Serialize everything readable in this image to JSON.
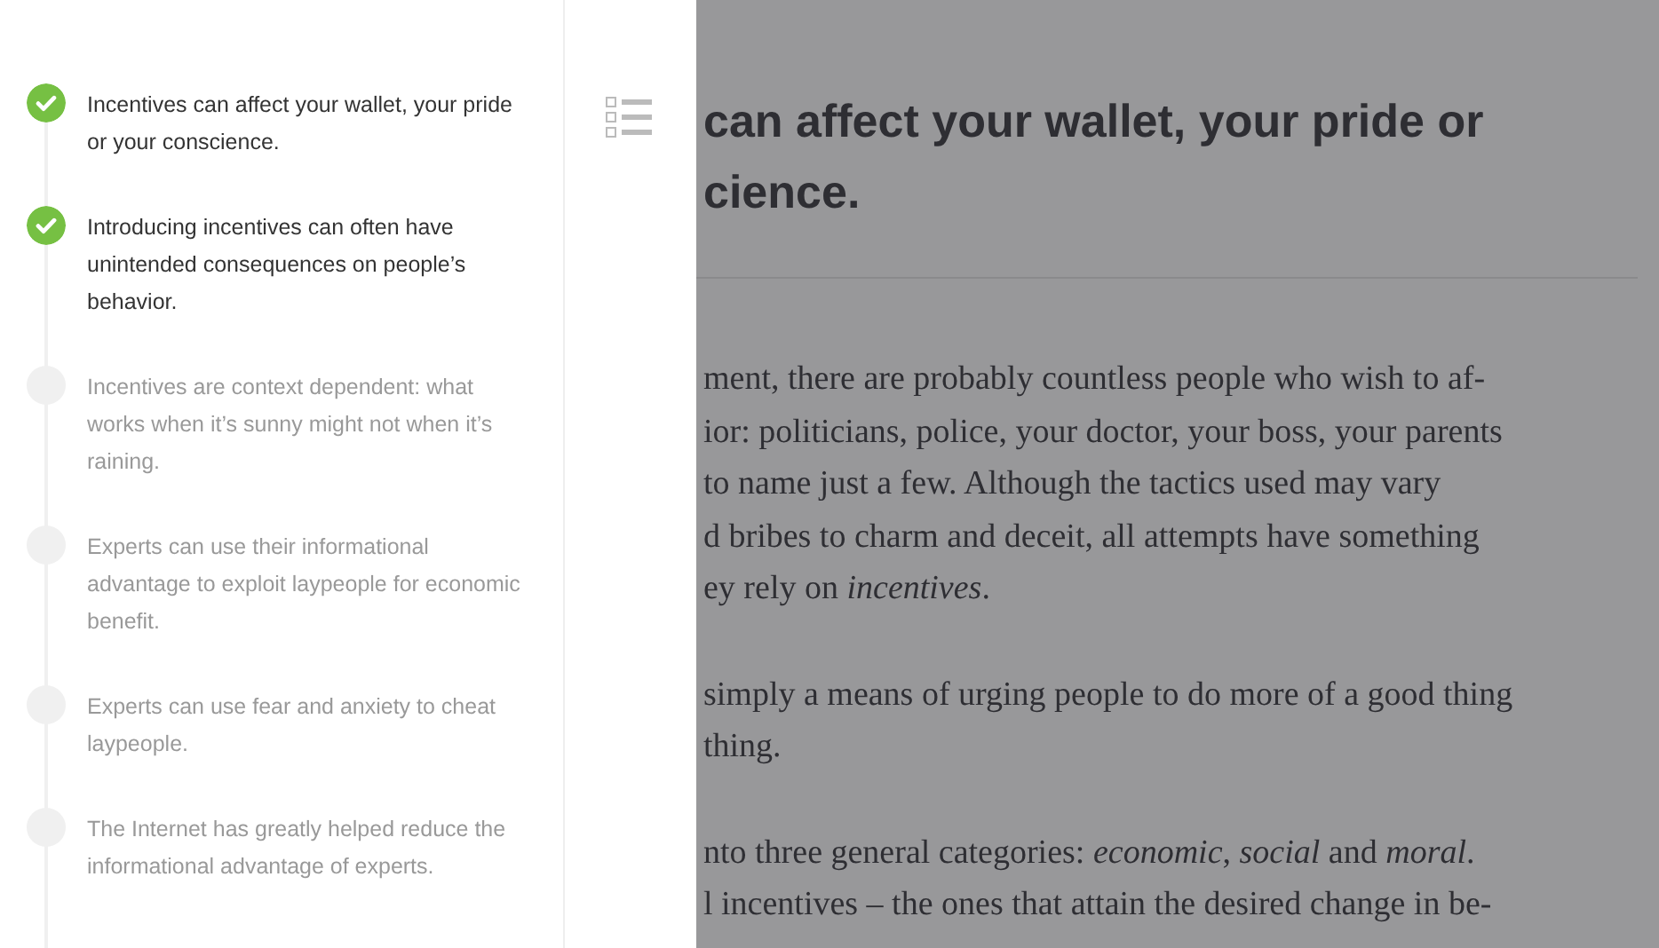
{
  "chapters": [
    {
      "title": "Incentives can affect your wallet, your pride or your conscience.",
      "completed": true
    },
    {
      "title": "Introducing incentives can often have unintended consequences on people’s behavior.",
      "completed": true
    },
    {
      "title": "Incentives are context dependent: what works when it’s sunny might not when it’s raining.",
      "completed": false
    },
    {
      "title": "Experts can use their informational advantage to exploit laypeople for economic benefit.",
      "completed": false
    },
    {
      "title": "Experts can use fear and anxiety to cheat laypeople.",
      "completed": false
    },
    {
      "title": "The Internet has greatly helped reduce the informational advantage of experts.",
      "completed": false
    }
  ],
  "article": {
    "heading_lines": [
      "can affect your wallet, your pride or",
      "cience."
    ],
    "paragraphs": [
      [
        "ment, there are probably countless people who wish to af-",
        "ior: politicians, police, your doctor, your boss, your parents",
        "to name just a few. Although the tactics used may vary",
        "d bribes to charm and deceit, all attempts have something",
        "ey rely on *incentives*."
      ],
      [
        "simply a means of urging people to do more of a good thing",
        "thing."
      ],
      [
        "nto three general categories: *economic*, *social* and *moral*.",
        "l incentives – the ones that attain the desired change in be-"
      ]
    ]
  }
}
